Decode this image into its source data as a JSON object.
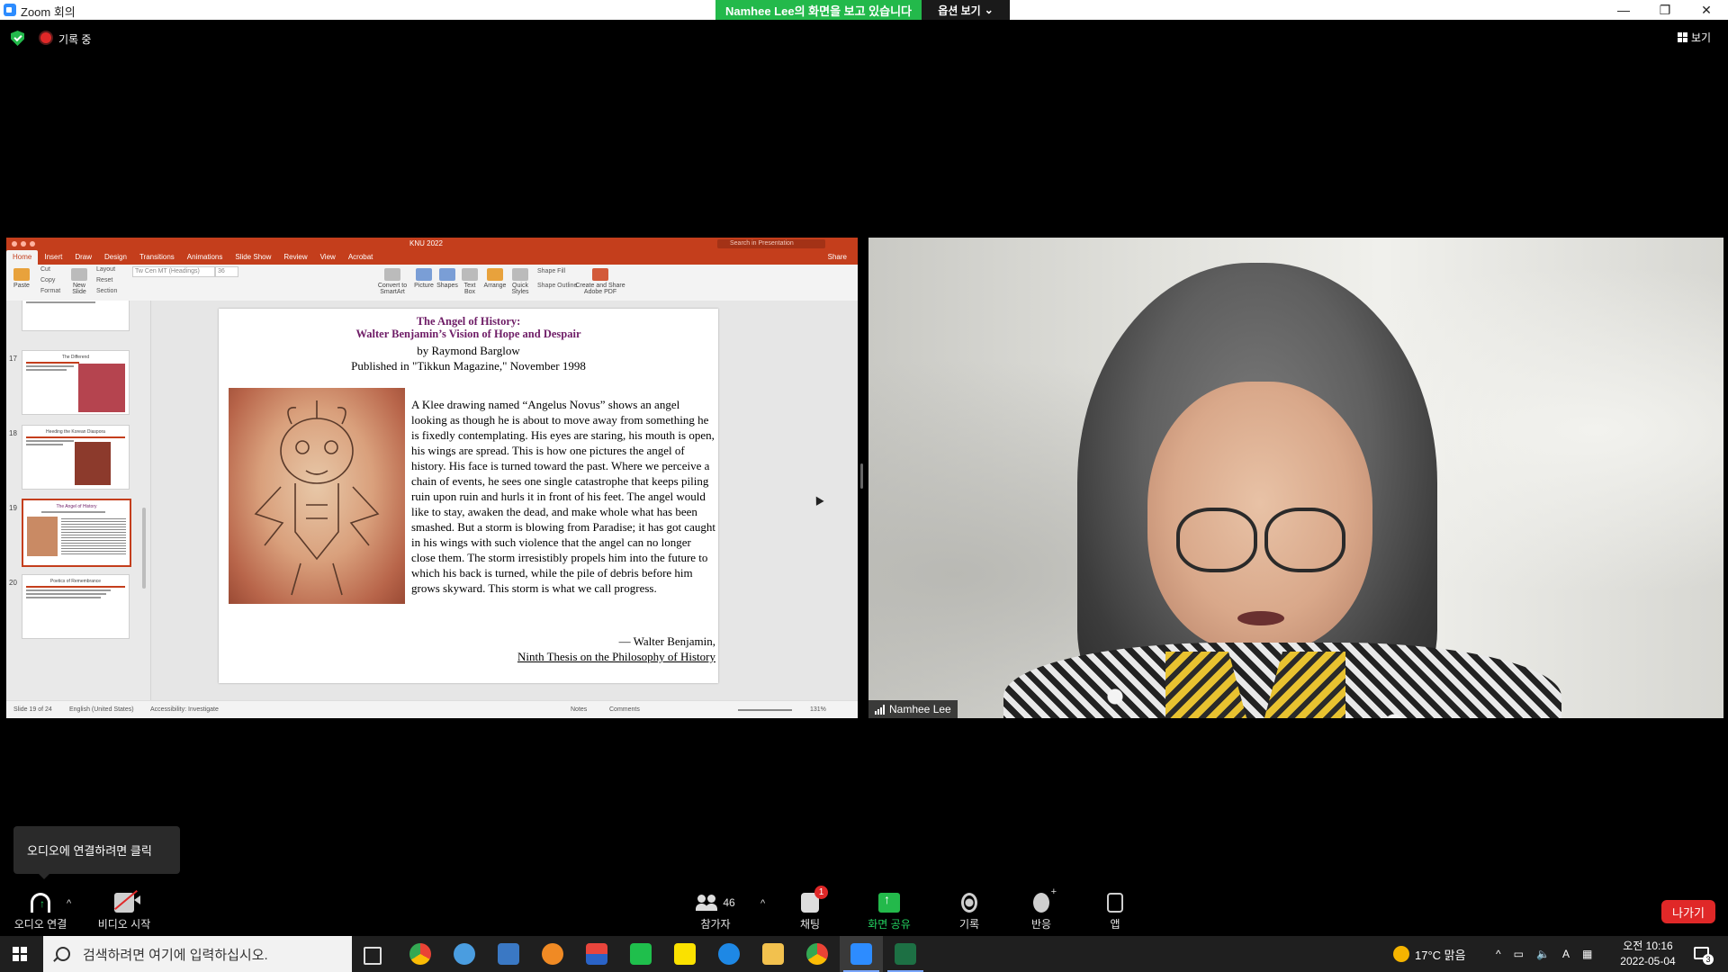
{
  "window": {
    "title": "Zoom 회의",
    "share_banner": "Namhee Lee의 화면을 보고 있습니다",
    "view_options": "옵션 보기",
    "minimize": "—",
    "maximize": "❐",
    "close": "✕"
  },
  "status": {
    "recording_label": "기록 중",
    "view_label": "보기"
  },
  "ppt": {
    "doc_title": "KNU 2022",
    "search_placeholder": "Search in Presentation",
    "share_label": "Share",
    "tabs": [
      "Home",
      "Insert",
      "Draw",
      "Design",
      "Transitions",
      "Animations",
      "Slide Show",
      "Review",
      "View",
      "Acrobat"
    ],
    "ribbon": {
      "paste": "Paste",
      "cut": "Cut",
      "copy": "Copy",
      "format": "Format",
      "new_slide": "New Slide",
      "layout": "Layout",
      "reset": "Reset",
      "section": "Section",
      "font_name": "Tw Cen MT (Headings)",
      "font_size": "36",
      "convert": "Convert to SmartArt",
      "picture": "Picture",
      "shapes": "Shapes",
      "text_box": "Text Box",
      "arrange": "Arrange",
      "quick_styles": "Quick Styles",
      "shape_fill": "Shape Fill",
      "shape_outline": "Shape Outline",
      "create_pdf": "Create and Share Adobe PDF"
    },
    "thumbnails": [
      {
        "num": "17",
        "title": "The Differend"
      },
      {
        "num": "18",
        "title": "Heeding the Korean Diaspora"
      },
      {
        "num": "19",
        "title": "The Angel of History"
      },
      {
        "num": "20",
        "title": "Poetics of Remembrance"
      }
    ],
    "slide": {
      "title_line1": "The Angel of History:",
      "title_line2": "Walter Benjamin’s Vision of Hope and Despair",
      "author": "by Raymond Barglow",
      "published": "Published in \"Tikkun Magazine,\" November 1998",
      "body": "A Klee drawing named “Angelus Novus” shows an angel looking as though he is about to move away from something he is fixedly contemplating.  His eyes are staring, his mouth is open, his wings are spread.  This is how one pictures the angel of history.  His face is turned toward the past.  Where we perceive a chain of events, he sees one single catastrophe that keeps piling ruin upon ruin and hurls it in front of his feet.  The angel would like to stay, awaken the dead, and make whole what has been smashed.  But a storm is blowing from Paradise; it has got caught in his wings with such violence that the angel can no longer close them.  The storm irresistibly propels him into the future to which his back is turned, while the pile of debris before him grows skyward. This storm is what we call progress.",
      "quote_author": "— Walter Benjamin,",
      "quote_source": "Ninth Thesis on the Philosophy of History"
    },
    "statusbar": {
      "slide_count": "Slide 19 of 24",
      "language": "English (United States)",
      "accessibility": "Accessibility: Investigate",
      "notes": "Notes",
      "comments": "Comments",
      "zoom": "131%"
    }
  },
  "video": {
    "participant_name": "Namhee Lee"
  },
  "tooltip": "오디오에 연결하려면 클릭",
  "toolbar": {
    "audio": "오디오 연결",
    "video": "비디오 시작",
    "participants_count": "46",
    "participants": "참가자",
    "chat": "채팅",
    "chat_badge": "1",
    "share": "화면 공유",
    "record": "기록",
    "reactions": "반응",
    "apps": "앱",
    "leave": "나가기",
    "share_color": "#23d160",
    "leave_color": "#e02828"
  },
  "taskbar": {
    "search_placeholder": "검색하려면 여기에 입력하십시오.",
    "weather": "17°C  맑음",
    "ime": "A",
    "time": "오전 10:16",
    "date": "2022-05-04",
    "notification_count": "3"
  }
}
